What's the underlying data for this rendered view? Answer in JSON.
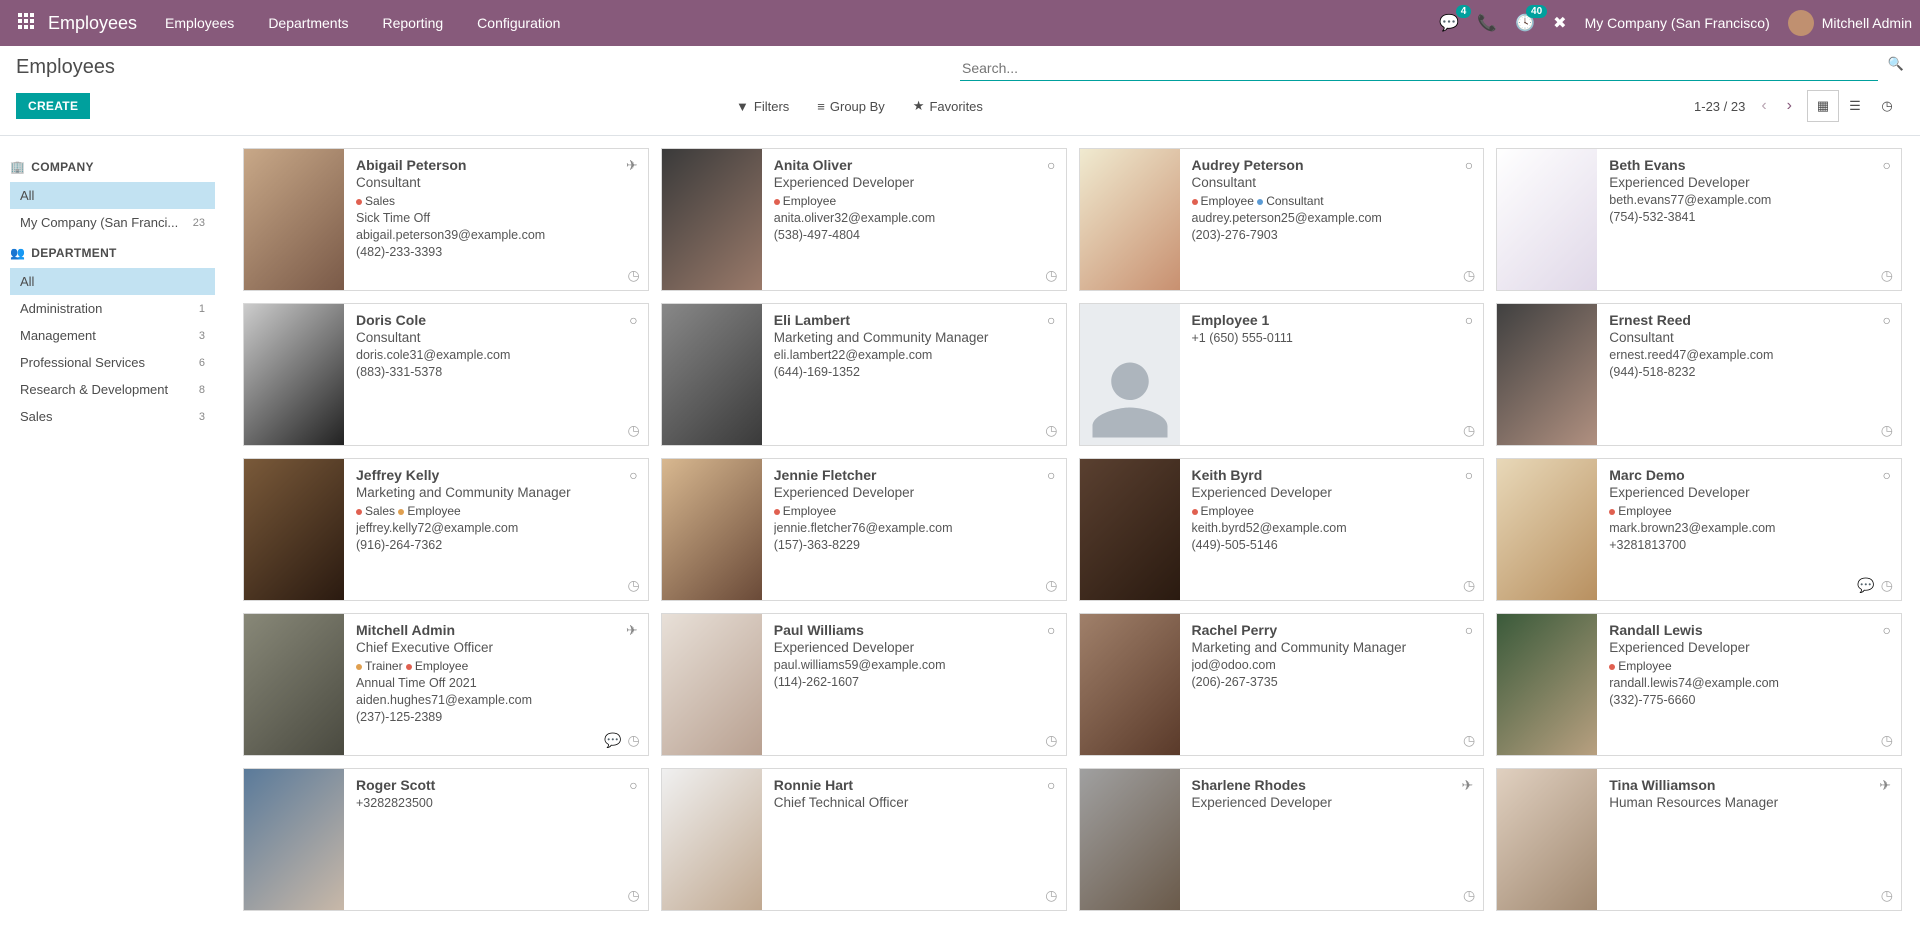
{
  "nav": {
    "app_title": "Employees",
    "items": [
      "Employees",
      "Departments",
      "Reporting",
      "Configuration"
    ],
    "msg_badge": "4",
    "activity_badge": "40",
    "company": "My Company (San Francisco)",
    "user": "Mitchell Admin"
  },
  "header": {
    "title": "Employees",
    "search_placeholder": "Search...",
    "create_label": "CREATE",
    "filters": "Filters",
    "groupby": "Group By",
    "favorites": "Favorites",
    "pager": "1-23 / 23"
  },
  "sidebar": {
    "company_title": "COMPANY",
    "company_items": [
      {
        "label": "All",
        "count": "",
        "active": true
      },
      {
        "label": "My Company (San Franci...",
        "count": "23"
      }
    ],
    "dept_title": "DEPARTMENT",
    "dept_items": [
      {
        "label": "All",
        "count": "",
        "active": true
      },
      {
        "label": "Administration",
        "count": "1"
      },
      {
        "label": "Management",
        "count": "3"
      },
      {
        "label": "Professional Services",
        "count": "6"
      },
      {
        "label": "Research & Development",
        "count": "8"
      },
      {
        "label": "Sales",
        "count": "3"
      }
    ]
  },
  "employees": [
    {
      "name": "Abigail Peterson",
      "role": "Consultant",
      "tags": [
        {
          "label": "Sales",
          "color": "#e06050"
        }
      ],
      "lines": [
        "Sick Time Off",
        "abigail.peterson39@example.com",
        "(482)-233-3393"
      ],
      "status": "plane",
      "img": "g1"
    },
    {
      "name": "Anita Oliver",
      "role": "Experienced Developer",
      "tags": [
        {
          "label": "Employee",
          "color": "#e06050"
        }
      ],
      "lines": [
        "anita.oliver32@example.com",
        "(538)-497-4804"
      ],
      "status": "circle",
      "img": "g2"
    },
    {
      "name": "Audrey Peterson",
      "role": "Consultant",
      "tags": [
        {
          "label": "Employee",
          "color": "#e06050"
        },
        {
          "label": "Consultant",
          "color": "#5b9bd5"
        }
      ],
      "lines": [
        "audrey.peterson25@example.com",
        "(203)-276-7903"
      ],
      "status": "circle",
      "img": "g3"
    },
    {
      "name": "Beth Evans",
      "role": "Experienced Developer",
      "tags": [],
      "lines": [
        "beth.evans77@example.com",
        "(754)-532-3841"
      ],
      "status": "circle",
      "img": "g4"
    },
    {
      "name": "Doris Cole",
      "role": "Consultant",
      "tags": [],
      "lines": [
        "doris.cole31@example.com",
        "(883)-331-5378"
      ],
      "status": "circle",
      "img": "g5"
    },
    {
      "name": "Eli Lambert",
      "role": "Marketing and Community Manager",
      "tags": [],
      "lines": [
        "eli.lambert22@example.com",
        "(644)-169-1352"
      ],
      "status": "circle",
      "img": "g6"
    },
    {
      "name": "Employee 1",
      "role": "",
      "tags": [],
      "lines": [
        "+1 (650) 555-0111"
      ],
      "status": "circle",
      "img": "placeholder"
    },
    {
      "name": "Ernest Reed",
      "role": "Consultant",
      "tags": [],
      "lines": [
        "ernest.reed47@example.com",
        "(944)-518-8232"
      ],
      "status": "circle",
      "img": "g7"
    },
    {
      "name": "Jeffrey Kelly",
      "role": "Marketing and Community Manager",
      "tags": [
        {
          "label": "Sales",
          "color": "#e06050"
        },
        {
          "label": "Employee",
          "color": "#e0a050"
        }
      ],
      "lines": [
        "jeffrey.kelly72@example.com",
        "(916)-264-7362"
      ],
      "status": "circle",
      "img": "g8"
    },
    {
      "name": "Jennie Fletcher",
      "role": "Experienced Developer",
      "tags": [
        {
          "label": "Employee",
          "color": "#e06050"
        }
      ],
      "lines": [
        "jennie.fletcher76@example.com",
        "(157)-363-8229"
      ],
      "status": "circle",
      "img": "g9"
    },
    {
      "name": "Keith Byrd",
      "role": "Experienced Developer",
      "tags": [
        {
          "label": "Employee",
          "color": "#e06050"
        }
      ],
      "lines": [
        "keith.byrd52@example.com",
        "(449)-505-5146"
      ],
      "status": "circle",
      "img": "g10"
    },
    {
      "name": "Marc Demo",
      "role": "Experienced Developer",
      "tags": [
        {
          "label": "Employee",
          "color": "#e06050"
        }
      ],
      "lines": [
        "mark.brown23@example.com",
        "+3281813700"
      ],
      "status": "circle",
      "activity": true,
      "img": "g11"
    },
    {
      "name": "Mitchell Admin",
      "role": "Chief Executive Officer",
      "tags": [
        {
          "label": "Trainer",
          "color": "#e0a050"
        },
        {
          "label": "Employee",
          "color": "#e06050"
        }
      ],
      "lines": [
        "Annual Time Off 2021",
        "aiden.hughes71@example.com",
        "(237)-125-2389"
      ],
      "status": "plane",
      "activity": true,
      "img": "g12"
    },
    {
      "name": "Paul Williams",
      "role": "Experienced Developer",
      "tags": [],
      "lines": [
        "paul.williams59@example.com",
        "(114)-262-1607"
      ],
      "status": "circle",
      "img": "g13"
    },
    {
      "name": "Rachel Perry",
      "role": "Marketing and Community Manager",
      "tags": [],
      "lines": [
        "jod@odoo.com",
        "(206)-267-3735"
      ],
      "status": "circle",
      "img": "g14"
    },
    {
      "name": "Randall Lewis",
      "role": "Experienced Developer",
      "tags": [
        {
          "label": "Employee",
          "color": "#e06050"
        }
      ],
      "lines": [
        "randall.lewis74@example.com",
        "(332)-775-6660"
      ],
      "status": "circle",
      "img": "g15"
    },
    {
      "name": "Roger Scott",
      "role": "",
      "tags": [],
      "lines": [
        "+3282823500"
      ],
      "status": "circle",
      "img": "g16"
    },
    {
      "name": "Ronnie Hart",
      "role": "Chief Technical Officer",
      "tags": [],
      "lines": [],
      "status": "circle",
      "img": "g17"
    },
    {
      "name": "Sharlene Rhodes",
      "role": "Experienced Developer",
      "tags": [],
      "lines": [],
      "status": "plane",
      "img": "g18"
    },
    {
      "name": "Tina Williamson",
      "role": "Human Resources Manager",
      "tags": [],
      "lines": [],
      "status": "plane",
      "img": "g19"
    }
  ],
  "gradients": {
    "g1": "linear-gradient(135deg,#c8a888,#7a5a48)",
    "g2": "linear-gradient(135deg,#3a3a3a,#9a7a6a)",
    "g3": "linear-gradient(135deg,#f0ead0,#c89070)",
    "g4": "linear-gradient(135deg,#ffffff,#e0d8e8)",
    "g5": "linear-gradient(135deg,#cccccc,#222222)",
    "g6": "linear-gradient(135deg,#888888,#3a3a3a)",
    "g7": "linear-gradient(135deg,#404040,#b09080)",
    "g8": "linear-gradient(135deg,#7a5a3a,#2a1a10)",
    "g9": "linear-gradient(135deg,#d8b890,#6a4a38)",
    "g10": "linear-gradient(135deg,#5a4030,#2a1a10)",
    "g11": "linear-gradient(135deg,#e8d8b8,#b89060)",
    "g12": "linear-gradient(135deg,#888878,#4a4a40)",
    "g13": "linear-gradient(135deg,#e8e0d8,#b8a090)",
    "g14": "linear-gradient(135deg,#a0806a,#5a3a2a)",
    "g15": "linear-gradient(135deg,#3a5a3a,#b8a080)",
    "g16": "linear-gradient(135deg,#5a7a9a,#c8b8a8)",
    "g17": "linear-gradient(135deg,#f0f0f0,#c0a890)",
    "g18": "linear-gradient(135deg,#a0a0a0,#6a5a4a)",
    "g19": "linear-gradient(135deg,#e0d0c0,#a08870)"
  }
}
